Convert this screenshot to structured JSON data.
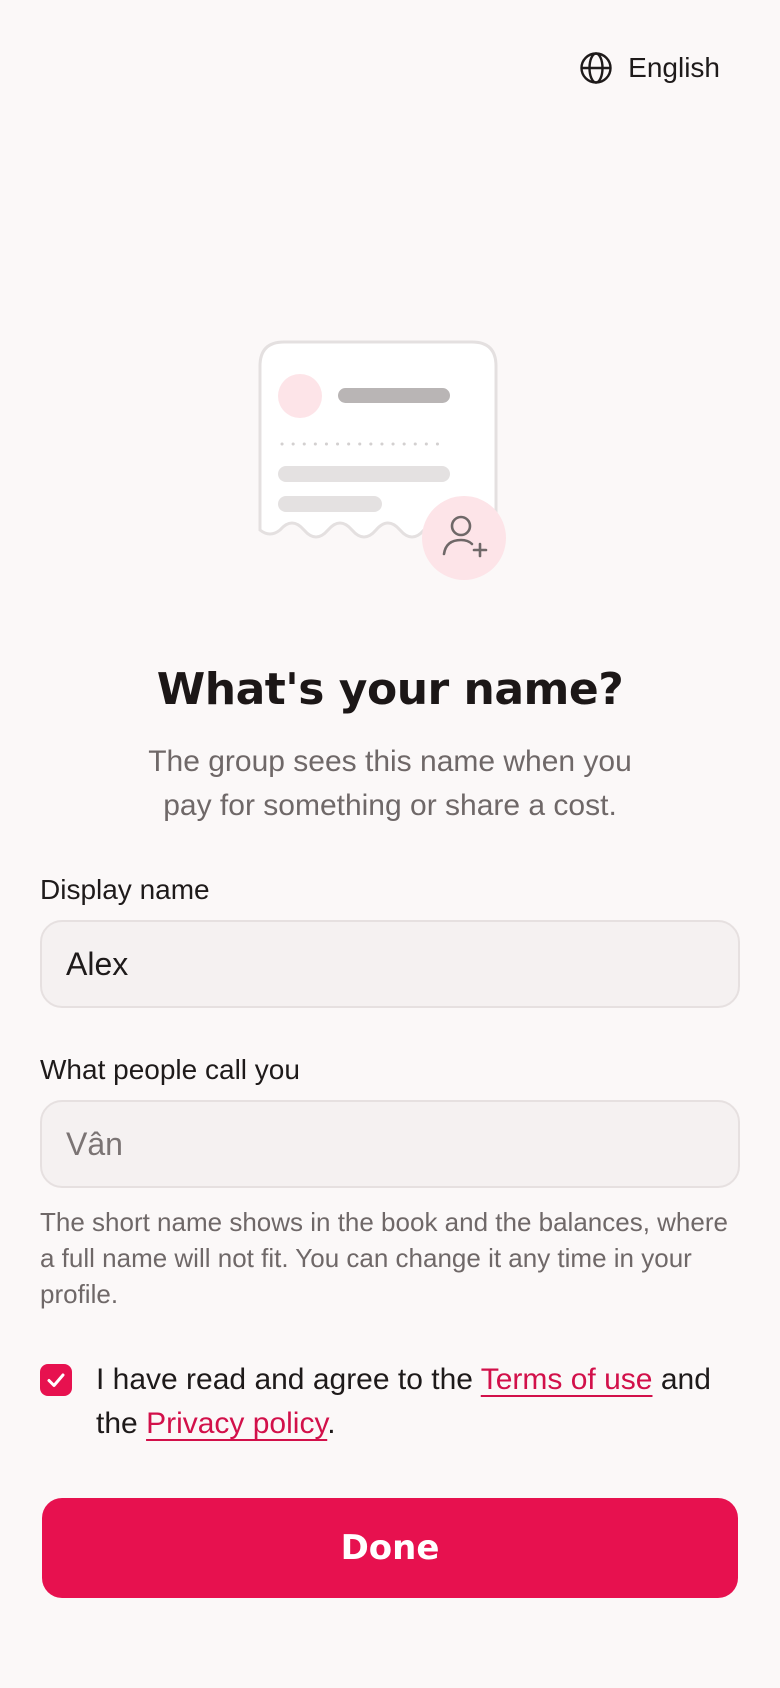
{
  "language": {
    "icon": "globe-icon",
    "label": "English"
  },
  "illustration": {
    "icon": "add-user-icon",
    "accent": "#fde4e8"
  },
  "heading": "What's your name?",
  "subtitle": "The group sees this name when you pay for something or share a cost.",
  "display_name": {
    "label": "Display name",
    "value": "Alex"
  },
  "nickname": {
    "label": "What people call you",
    "value": "",
    "placeholder": "Vân"
  },
  "hint": "The short name shows in the book and the balances, where a full name will not fit. You can change it any time in your profile.",
  "consent": {
    "checked": true,
    "prefix": "I have read and agree to the",
    "terms_link": "Terms of use",
    "middle": "and the",
    "privacy_link": "Privacy policy",
    "suffix": "."
  },
  "done_button": "Done",
  "colors": {
    "primary": "#e7114f",
    "link": "#d2104a",
    "background": "#fbf8f8"
  }
}
